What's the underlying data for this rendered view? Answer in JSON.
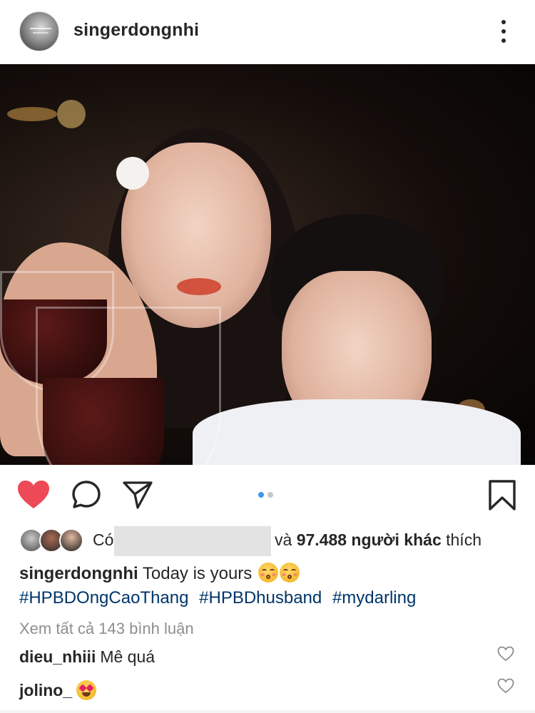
{
  "header": {
    "username": "singerdongnhi",
    "more_icon": "more-vertical-icon"
  },
  "post": {
    "carousel_total": 2,
    "carousel_active": 1,
    "liked": true,
    "colors": {
      "heart": "#ed4956",
      "dot_active": "#3897f0",
      "dot_inactive": "#c7c7c7",
      "hashtag": "#003569",
      "muted": "#8e8e8e"
    }
  },
  "likes": {
    "prefix": "Có",
    "and": "và",
    "count": "97.488 người khác",
    "suffix": "thích"
  },
  "caption": {
    "username": "singerdongnhi",
    "text": "Today is yours",
    "emoji": "kissing-closed-eyes-emoji",
    "hashtags": [
      "#HPBDOngCaoThang",
      "#HPBDhusband",
      "#mydarling"
    ]
  },
  "comments_link": "Xem tất cả 143 bình luận",
  "comments": [
    {
      "username": "dieu_nhiii",
      "text": "Mê quá"
    },
    {
      "username": "jolino_",
      "text": "",
      "emoji": "heart-eyes-emoji"
    }
  ]
}
